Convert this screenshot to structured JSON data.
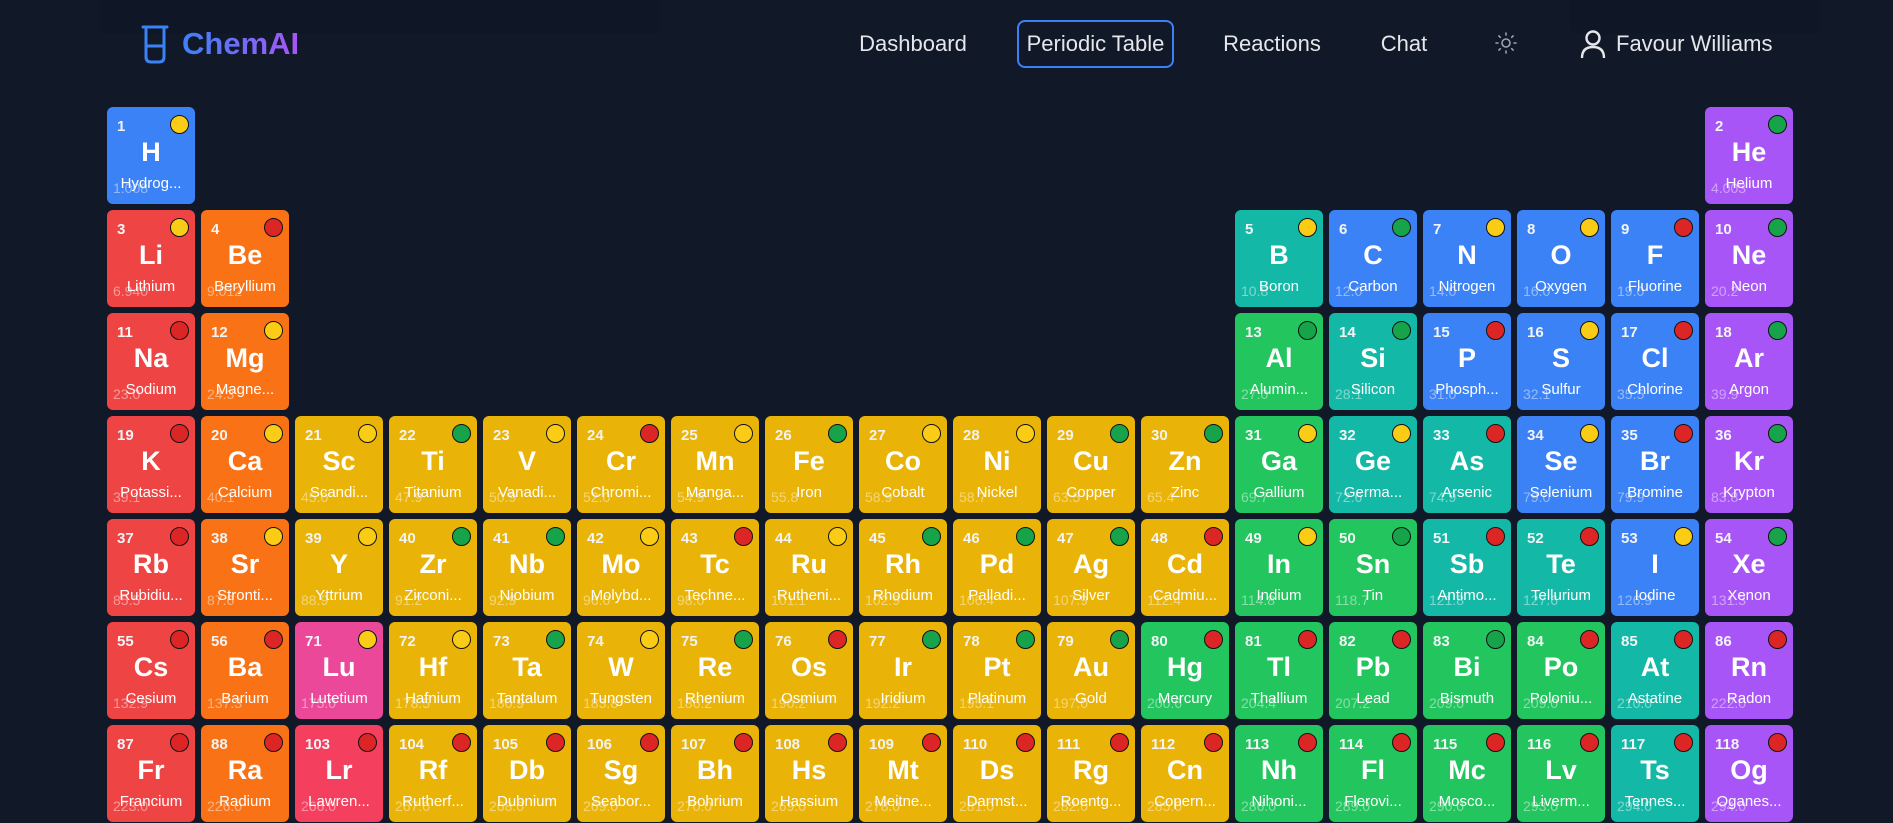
{
  "app": {
    "name": "ChemAI"
  },
  "nav": {
    "dashboard": "Dashboard",
    "periodic_table": "Periodic Table",
    "reactions": "Reactions",
    "chat": "Chat"
  },
  "user": {
    "name": "Favour Williams"
  },
  "colors": {
    "alkali": "#ef4444",
    "alkaline": "#f97316",
    "transition": "#eab308",
    "post": "#22c55e",
    "metalloid": "#14b8a6",
    "nonmetal": "#3b82f6",
    "noble": "#a855f7",
    "lanthanide": "#ec4899",
    "actinide": "#f43f5e",
    "state_yellow": "#facc15",
    "state_green": "#16a34a",
    "state_red": "#dc2626"
  },
  "elements": [
    {
      "n": 1,
      "s": "H",
      "name": "Hydrog...",
      "mass": "1.008",
      "cat": "nonmetal",
      "st": "y",
      "row": 1,
      "col": 1
    },
    {
      "n": 2,
      "s": "He",
      "name": "Helium",
      "mass": "4.003",
      "cat": "noble",
      "st": "g",
      "row": 1,
      "col": 18
    },
    {
      "n": 3,
      "s": "Li",
      "name": "Lithium",
      "mass": "6.940",
      "cat": "alkali",
      "st": "y",
      "row": 2,
      "col": 1
    },
    {
      "n": 4,
      "s": "Be",
      "name": "Beryllium",
      "mass": "9.012",
      "cat": "alkaline",
      "st": "r",
      "row": 2,
      "col": 2
    },
    {
      "n": 5,
      "s": "B",
      "name": "Boron",
      "mass": "10.8",
      "cat": "metalloid",
      "st": "y",
      "row": 2,
      "col": 13
    },
    {
      "n": 6,
      "s": "C",
      "name": "Carbon",
      "mass": "12.0",
      "cat": "nonmetal",
      "st": "g",
      "row": 2,
      "col": 14
    },
    {
      "n": 7,
      "s": "N",
      "name": "Nitrogen",
      "mass": "14.0",
      "cat": "nonmetal",
      "st": "y",
      "row": 2,
      "col": 15
    },
    {
      "n": 8,
      "s": "O",
      "name": "Oxygen",
      "mass": "16.0",
      "cat": "nonmetal",
      "st": "y",
      "row": 2,
      "col": 16
    },
    {
      "n": 9,
      "s": "F",
      "name": "Fluorine",
      "mass": "19.0",
      "cat": "nonmetal",
      "st": "r",
      "row": 2,
      "col": 17
    },
    {
      "n": 10,
      "s": "Ne",
      "name": "Neon",
      "mass": "20.2",
      "cat": "noble",
      "st": "g",
      "row": 2,
      "col": 18
    },
    {
      "n": 11,
      "s": "Na",
      "name": "Sodium",
      "mass": "23.0",
      "cat": "alkali",
      "st": "r",
      "row": 3,
      "col": 1
    },
    {
      "n": 12,
      "s": "Mg",
      "name": "Magne...",
      "mass": "24.3",
      "cat": "alkaline",
      "st": "y",
      "row": 3,
      "col": 2
    },
    {
      "n": 13,
      "s": "Al",
      "name": "Alumin...",
      "mass": "27.0",
      "cat": "post",
      "st": "g",
      "row": 3,
      "col": 13
    },
    {
      "n": 14,
      "s": "Si",
      "name": "Silicon",
      "mass": "28.1",
      "cat": "metalloid",
      "st": "g",
      "row": 3,
      "col": 14
    },
    {
      "n": 15,
      "s": "P",
      "name": "Phosph...",
      "mass": "31.0",
      "cat": "nonmetal",
      "st": "r",
      "row": 3,
      "col": 15
    },
    {
      "n": 16,
      "s": "S",
      "name": "Sulfur",
      "mass": "32.1",
      "cat": "nonmetal",
      "st": "y",
      "row": 3,
      "col": 16
    },
    {
      "n": 17,
      "s": "Cl",
      "name": "Chlorine",
      "mass": "35.5",
      "cat": "nonmetal",
      "st": "r",
      "row": 3,
      "col": 17
    },
    {
      "n": 18,
      "s": "Ar",
      "name": "Argon",
      "mass": "39.9",
      "cat": "noble",
      "st": "g",
      "row": 3,
      "col": 18
    },
    {
      "n": 19,
      "s": "K",
      "name": "Potassi...",
      "mass": "39.1",
      "cat": "alkali",
      "st": "r",
      "row": 4,
      "col": 1
    },
    {
      "n": 20,
      "s": "Ca",
      "name": "Calcium",
      "mass": "40.1",
      "cat": "alkaline",
      "st": "y",
      "row": 4,
      "col": 2
    },
    {
      "n": 21,
      "s": "Sc",
      "name": "Scandi...",
      "mass": "45.0",
      "cat": "transition",
      "st": "y",
      "row": 4,
      "col": 3
    },
    {
      "n": 22,
      "s": "Ti",
      "name": "Titanium",
      "mass": "47.9",
      "cat": "transition",
      "st": "g",
      "row": 4,
      "col": 4
    },
    {
      "n": 23,
      "s": "V",
      "name": "Vanadi...",
      "mass": "50.9",
      "cat": "transition",
      "st": "y",
      "row": 4,
      "col": 5
    },
    {
      "n": 24,
      "s": "Cr",
      "name": "Chromi...",
      "mass": "52.0",
      "cat": "transition",
      "st": "r",
      "row": 4,
      "col": 6
    },
    {
      "n": 25,
      "s": "Mn",
      "name": "Manga...",
      "mass": "54.9",
      "cat": "transition",
      "st": "y",
      "row": 4,
      "col": 7
    },
    {
      "n": 26,
      "s": "Fe",
      "name": "Iron",
      "mass": "55.8",
      "cat": "transition",
      "st": "g",
      "row": 4,
      "col": 8
    },
    {
      "n": 27,
      "s": "Co",
      "name": "Cobalt",
      "mass": "58.9",
      "cat": "transition",
      "st": "y",
      "row": 4,
      "col": 9
    },
    {
      "n": 28,
      "s": "Ni",
      "name": "Nickel",
      "mass": "58.7",
      "cat": "transition",
      "st": "y",
      "row": 4,
      "col": 10
    },
    {
      "n": 29,
      "s": "Cu",
      "name": "Copper",
      "mass": "63.5",
      "cat": "transition",
      "st": "g",
      "row": 4,
      "col": 11
    },
    {
      "n": 30,
      "s": "Zn",
      "name": "Zinc",
      "mass": "65.4",
      "cat": "transition",
      "st": "g",
      "row": 4,
      "col": 12
    },
    {
      "n": 31,
      "s": "Ga",
      "name": "Gallium",
      "mass": "69.7",
      "cat": "post",
      "st": "y",
      "row": 4,
      "col": 13
    },
    {
      "n": 32,
      "s": "Ge",
      "name": "Germa...",
      "mass": "72.6",
      "cat": "metalloid",
      "st": "y",
      "row": 4,
      "col": 14
    },
    {
      "n": 33,
      "s": "As",
      "name": "Arsenic",
      "mass": "74.9",
      "cat": "metalloid",
      "st": "r",
      "row": 4,
      "col": 15
    },
    {
      "n": 34,
      "s": "Se",
      "name": "Selenium",
      "mass": "79.0",
      "cat": "nonmetal",
      "st": "y",
      "row": 4,
      "col": 16
    },
    {
      "n": 35,
      "s": "Br",
      "name": "Bromine",
      "mass": "79.9",
      "cat": "nonmetal",
      "st": "r",
      "row": 4,
      "col": 17
    },
    {
      "n": 36,
      "s": "Kr",
      "name": "Krypton",
      "mass": "83.8",
      "cat": "noble",
      "st": "g",
      "row": 4,
      "col": 18
    },
    {
      "n": 37,
      "s": "Rb",
      "name": "Rubidiu...",
      "mass": "85.5",
      "cat": "alkali",
      "st": "r",
      "row": 5,
      "col": 1
    },
    {
      "n": 38,
      "s": "Sr",
      "name": "Stronti...",
      "mass": "87.6",
      "cat": "alkaline",
      "st": "y",
      "row": 5,
      "col": 2
    },
    {
      "n": 39,
      "s": "Y",
      "name": "Yttrium",
      "mass": "88.9",
      "cat": "transition",
      "st": "y",
      "row": 5,
      "col": 3
    },
    {
      "n": 40,
      "s": "Zr",
      "name": "Zirconi...",
      "mass": "91.2",
      "cat": "transition",
      "st": "g",
      "row": 5,
      "col": 4
    },
    {
      "n": 41,
      "s": "Nb",
      "name": "Niobium",
      "mass": "92.9",
      "cat": "transition",
      "st": "g",
      "row": 5,
      "col": 5
    },
    {
      "n": 42,
      "s": "Mo",
      "name": "Molybd...",
      "mass": "96.0",
      "cat": "transition",
      "st": "y",
      "row": 5,
      "col": 6
    },
    {
      "n": 43,
      "s": "Tc",
      "name": "Techne...",
      "mass": "98.0",
      "cat": "transition",
      "st": "r",
      "row": 5,
      "col": 7
    },
    {
      "n": 44,
      "s": "Ru",
      "name": "Rutheni...",
      "mass": "101.1",
      "cat": "transition",
      "st": "y",
      "row": 5,
      "col": 8
    },
    {
      "n": 45,
      "s": "Rh",
      "name": "Rhodium",
      "mass": "102.9",
      "cat": "transition",
      "st": "g",
      "row": 5,
      "col": 9
    },
    {
      "n": 46,
      "s": "Pd",
      "name": "Palladi...",
      "mass": "106.4",
      "cat": "transition",
      "st": "g",
      "row": 5,
      "col": 10
    },
    {
      "n": 47,
      "s": "Ag",
      "name": "Silver",
      "mass": "107.9",
      "cat": "transition",
      "st": "g",
      "row": 5,
      "col": 11
    },
    {
      "n": 48,
      "s": "Cd",
      "name": "Cadmiu...",
      "mass": "112.4",
      "cat": "transition",
      "st": "r",
      "row": 5,
      "col": 12
    },
    {
      "n": 49,
      "s": "In",
      "name": "Indium",
      "mass": "114.8",
      "cat": "post",
      "st": "y",
      "row": 5,
      "col": 13
    },
    {
      "n": 50,
      "s": "Sn",
      "name": "Tin",
      "mass": "118.7",
      "cat": "post",
      "st": "g",
      "row": 5,
      "col": 14
    },
    {
      "n": 51,
      "s": "Sb",
      "name": "Antimo...",
      "mass": "121.8",
      "cat": "metalloid",
      "st": "r",
      "row": 5,
      "col": 15
    },
    {
      "n": 52,
      "s": "Te",
      "name": "Tellurium",
      "mass": "127.6",
      "cat": "metalloid",
      "st": "r",
      "row": 5,
      "col": 16
    },
    {
      "n": 53,
      "s": "I",
      "name": "Iodine",
      "mass": "126.9",
      "cat": "nonmetal",
      "st": "y",
      "row": 5,
      "col": 17
    },
    {
      "n": 54,
      "s": "Xe",
      "name": "Xenon",
      "mass": "131.3",
      "cat": "noble",
      "st": "g",
      "row": 5,
      "col": 18
    },
    {
      "n": 55,
      "s": "Cs",
      "name": "Cesium",
      "mass": "132.9",
      "cat": "alkali",
      "st": "r",
      "row": 6,
      "col": 1
    },
    {
      "n": 56,
      "s": "Ba",
      "name": "Barium",
      "mass": "137.3",
      "cat": "alkaline",
      "st": "r",
      "row": 6,
      "col": 2
    },
    {
      "n": 71,
      "s": "Lu",
      "name": "Lutetium",
      "mass": "175.0",
      "cat": "lanthanide",
      "st": "y",
      "row": 6,
      "col": 3
    },
    {
      "n": 72,
      "s": "Hf",
      "name": "Hafnium",
      "mass": "178.5",
      "cat": "transition",
      "st": "y",
      "row": 6,
      "col": 4
    },
    {
      "n": 73,
      "s": "Ta",
      "name": "Tantalum",
      "mass": "180.9",
      "cat": "transition",
      "st": "g",
      "row": 6,
      "col": 5
    },
    {
      "n": 74,
      "s": "W",
      "name": "Tungsten",
      "mass": "183.8",
      "cat": "transition",
      "st": "y",
      "row": 6,
      "col": 6
    },
    {
      "n": 75,
      "s": "Re",
      "name": "Rhenium",
      "mass": "186.2",
      "cat": "transition",
      "st": "g",
      "row": 6,
      "col": 7
    },
    {
      "n": 76,
      "s": "Os",
      "name": "Osmium",
      "mass": "190.2",
      "cat": "transition",
      "st": "r",
      "row": 6,
      "col": 8
    },
    {
      "n": 77,
      "s": "Ir",
      "name": "Iridium",
      "mass": "192.2",
      "cat": "transition",
      "st": "g",
      "row": 6,
      "col": 9
    },
    {
      "n": 78,
      "s": "Pt",
      "name": "Platinum",
      "mass": "195.1",
      "cat": "transition",
      "st": "g",
      "row": 6,
      "col": 10
    },
    {
      "n": 79,
      "s": "Au",
      "name": "Gold",
      "mass": "197.0",
      "cat": "transition",
      "st": "g",
      "row": 6,
      "col": 11
    },
    {
      "n": 80,
      "s": "Hg",
      "name": "Mercury",
      "mass": "200.6",
      "cat": "post",
      "st": "r",
      "row": 6,
      "col": 12
    },
    {
      "n": 81,
      "s": "Tl",
      "name": "Thallium",
      "mass": "204.4",
      "cat": "post",
      "st": "r",
      "row": 6,
      "col": 13
    },
    {
      "n": 82,
      "s": "Pb",
      "name": "Lead",
      "mass": "207.2",
      "cat": "post",
      "st": "r",
      "row": 6,
      "col": 14
    },
    {
      "n": 83,
      "s": "Bi",
      "name": "Bismuth",
      "mass": "209.0",
      "cat": "post",
      "st": "g",
      "row": 6,
      "col": 15
    },
    {
      "n": 84,
      "s": "Po",
      "name": "Poloniu...",
      "mass": "209.0",
      "cat": "post",
      "st": "r",
      "row": 6,
      "col": 16
    },
    {
      "n": 85,
      "s": "At",
      "name": "Astatine",
      "mass": "210.0",
      "cat": "metalloid",
      "st": "r",
      "row": 6,
      "col": 17
    },
    {
      "n": 86,
      "s": "Rn",
      "name": "Radon",
      "mass": "222.0",
      "cat": "noble",
      "st": "r",
      "row": 6,
      "col": 18
    },
    {
      "n": 87,
      "s": "Fr",
      "name": "Francium",
      "mass": "223.0",
      "cat": "alkali",
      "st": "r",
      "row": 7,
      "col": 1
    },
    {
      "n": 88,
      "s": "Ra",
      "name": "Radium",
      "mass": "226.0",
      "cat": "alkaline",
      "st": "r",
      "row": 7,
      "col": 2
    },
    {
      "n": 103,
      "s": "Lr",
      "name": "Lawren...",
      "mass": "266.0",
      "cat": "actinide",
      "st": "r",
      "row": 7,
      "col": 3
    },
    {
      "n": 104,
      "s": "Rf",
      "name": "Rutherf...",
      "mass": "267.0",
      "cat": "transition",
      "st": "r",
      "row": 7,
      "col": 4
    },
    {
      "n": 105,
      "s": "Db",
      "name": "Dubnium",
      "mass": "268.0",
      "cat": "transition",
      "st": "r",
      "row": 7,
      "col": 5
    },
    {
      "n": 106,
      "s": "Sg",
      "name": "Seabor...",
      "mass": "269.0",
      "cat": "transition",
      "st": "r",
      "row": 7,
      "col": 6
    },
    {
      "n": 107,
      "s": "Bh",
      "name": "Bohrium",
      "mass": "270.0",
      "cat": "transition",
      "st": "r",
      "row": 7,
      "col": 7
    },
    {
      "n": 108,
      "s": "Hs",
      "name": "Hassium",
      "mass": "269.0",
      "cat": "transition",
      "st": "r",
      "row": 7,
      "col": 8
    },
    {
      "n": 109,
      "s": "Mt",
      "name": "Meitne...",
      "mass": "278.0",
      "cat": "transition",
      "st": "r",
      "row": 7,
      "col": 9
    },
    {
      "n": 110,
      "s": "Ds",
      "name": "Darmst...",
      "mass": "281.0",
      "cat": "transition",
      "st": "r",
      "row": 7,
      "col": 10
    },
    {
      "n": 111,
      "s": "Rg",
      "name": "Roentg...",
      "mass": "282.0",
      "cat": "transition",
      "st": "r",
      "row": 7,
      "col": 11
    },
    {
      "n": 112,
      "s": "Cn",
      "name": "Copern...",
      "mass": "285.0",
      "cat": "transition",
      "st": "r",
      "row": 7,
      "col": 12
    },
    {
      "n": 113,
      "s": "Nh",
      "name": "Nihoni...",
      "mass": "286.0",
      "cat": "post",
      "st": "r",
      "row": 7,
      "col": 13
    },
    {
      "n": 114,
      "s": "Fl",
      "name": "Flerovi...",
      "mass": "289.0",
      "cat": "post",
      "st": "r",
      "row": 7,
      "col": 14
    },
    {
      "n": 115,
      "s": "Mc",
      "name": "Mosco...",
      "mass": "290.0",
      "cat": "post",
      "st": "r",
      "row": 7,
      "col": 15
    },
    {
      "n": 116,
      "s": "Lv",
      "name": "Liverm...",
      "mass": "293.0",
      "cat": "post",
      "st": "r",
      "row": 7,
      "col": 16
    },
    {
      "n": 117,
      "s": "Ts",
      "name": "Tennes...",
      "mass": "294.0",
      "cat": "metalloid",
      "st": "r",
      "row": 7,
      "col": 17
    },
    {
      "n": 118,
      "s": "Og",
      "name": "Oganes...",
      "mass": "294.0",
      "cat": "noble",
      "st": "r",
      "row": 7,
      "col": 18
    }
  ]
}
